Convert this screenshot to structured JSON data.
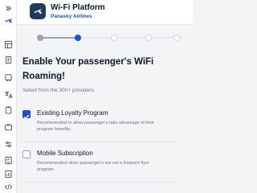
{
  "header": {
    "app_title": "Wi-Fi Platform",
    "airline": "Panasky Airlines"
  },
  "stepper": {
    "steps": [
      "done",
      "current",
      "todo",
      "todo",
      "todo"
    ]
  },
  "main": {
    "headline": "Enable Your passenger's WiFi Roaming!",
    "subline": "Select from the 300+ providers."
  },
  "options": [
    {
      "label": "Existing Loyalty Program",
      "description": "Recommended to allow passenger's take advantage of their program benefits.",
      "checked": true
    },
    {
      "label": "Mobile Subscription",
      "description": "Recommended when passenger's are not a frequent flyer program.",
      "checked": false
    }
  ],
  "sidebar": {
    "icons": [
      "collapse-icon",
      "plane-icon",
      "grid-icon",
      "document-icon",
      "bus-icon",
      "translate-icon",
      "clipboard-icon",
      "tv-icon",
      "sliders-icon",
      "form-icon",
      "report-icon",
      "code-icon"
    ]
  },
  "colors": {
    "accent": "#1d4ed8",
    "logo_bg": "#1f3a5f",
    "background": "#f3f4f6"
  }
}
